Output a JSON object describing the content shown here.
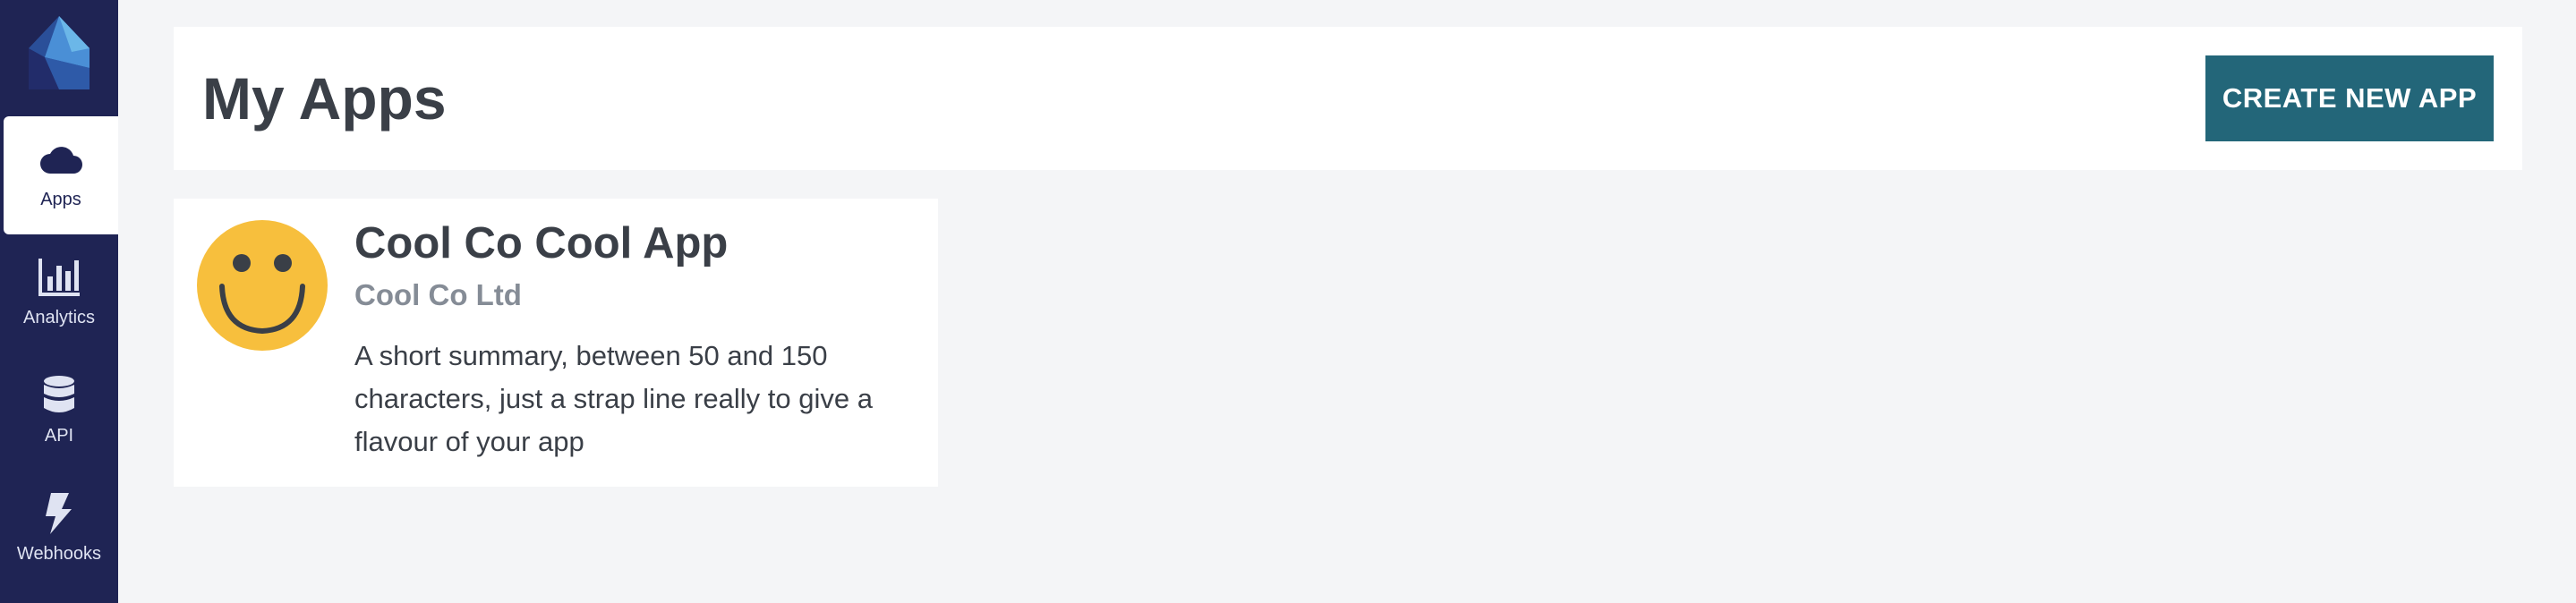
{
  "sidebar": {
    "logo_icon": "house-logo-icon",
    "items": [
      {
        "label": "Apps",
        "icon": "cloud-icon",
        "active": true
      },
      {
        "label": "Analytics",
        "icon": "bar-chart-icon",
        "active": false
      },
      {
        "label": "API",
        "icon": "database-icon",
        "active": false
      },
      {
        "label": "Webhooks",
        "icon": "lightning-icon",
        "active": false
      }
    ]
  },
  "header": {
    "title": "My Apps",
    "create_button_label": "CREATE NEW APP"
  },
  "apps": [
    {
      "name": "Cool Co Cool App",
      "company": "Cool Co Ltd",
      "summary": "A short summary, between 50 and 150 characters, just a strap line really to give a flavour of your app",
      "avatar_icon": "smiley-face-icon"
    }
  ],
  "colors": {
    "sidebar_bg": "#1f2454",
    "page_bg": "#f4f5f7",
    "accent_button": "#236679",
    "avatar_yellow": "#f7bf3d",
    "title_text": "#3a3f47",
    "muted_text": "#858c96"
  }
}
